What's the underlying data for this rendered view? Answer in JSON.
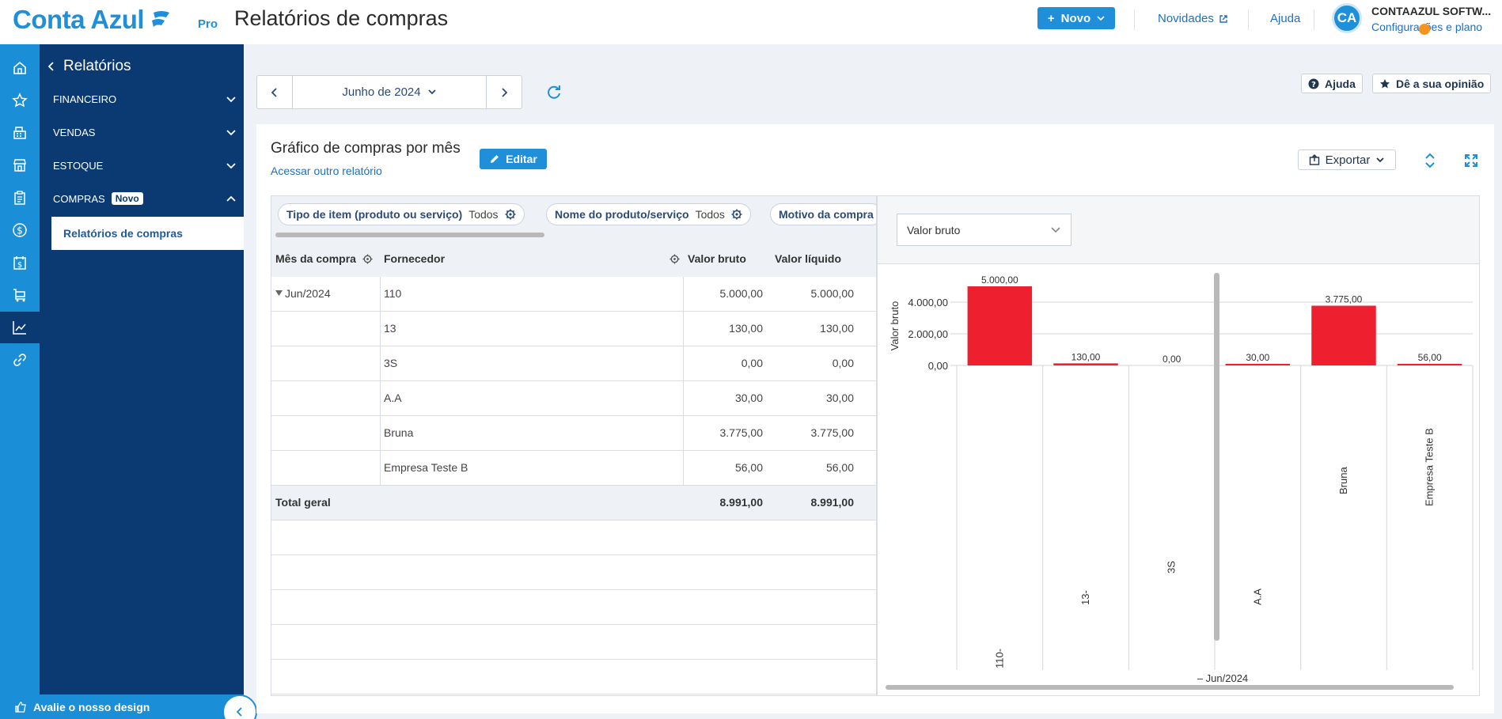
{
  "app": {
    "logo": "Conta Azul",
    "plan": "Pro",
    "page_title": "Relatórios de compras",
    "novo_label": "Novo",
    "novidades_label": "Novidades",
    "ajuda_label": "Ajuda",
    "avatar_initials": "CA",
    "company": "CONTAAZUL SOFTW...",
    "config_link": "Configurações e plano"
  },
  "rail": {
    "icons": [
      "home-icon",
      "star-icon",
      "register-icon",
      "store-icon",
      "clipboard-icon",
      "dollar-icon",
      "calendar-dollar-icon",
      "cart-icon",
      "chart-icon",
      "link-icon"
    ],
    "active": "chart-icon"
  },
  "subnav": {
    "title": "Relatórios",
    "sections": [
      {
        "label": "FINANCEIRO"
      },
      {
        "label": "VENDAS"
      },
      {
        "label": "ESTOQUE"
      },
      {
        "label": "COMPRAS",
        "badge": "Novo"
      }
    ],
    "active_item": "Relatórios de compras",
    "feedback": "Avalie o nosso design"
  },
  "toolbar": {
    "period": "Junho de 2024",
    "help_label": "Ajuda",
    "opinion_label": "Dê a sua opinião"
  },
  "report": {
    "title": "Gráfico de compras por mês",
    "other_link": "Acessar outro relatório",
    "edit_label": "Editar",
    "export_label": "Exportar",
    "filters": [
      {
        "key": "Tipo de item (produto ou serviço)",
        "value": "Todos"
      },
      {
        "key": "Nome do produto/serviço",
        "value": "Todos"
      },
      {
        "key": "Motivo da compra",
        "value": ""
      }
    ],
    "columns": [
      "Mês da compra",
      "Fornecedor",
      "Valor bruto",
      "Valor líquido"
    ],
    "month": "Jun/2024",
    "rows": [
      {
        "fornecedor": "110",
        "bruto": "5.000,00",
        "liquido": "5.000,00"
      },
      {
        "fornecedor": "13",
        "bruto": "130,00",
        "liquido": "130,00"
      },
      {
        "fornecedor": "3S",
        "bruto": "0,00",
        "liquido": "0,00"
      },
      {
        "fornecedor": "A.A",
        "bruto": "30,00",
        "liquido": "30,00"
      },
      {
        "fornecedor": "Bruna",
        "bruto": "3.775,00",
        "liquido": "3.775,00"
      },
      {
        "fornecedor": "Empresa Teste B",
        "bruto": "56,00",
        "liquido": "56,00"
      }
    ],
    "total_label": "Total geral",
    "total_bruto": "8.991,00",
    "total_liquido": "8.991,00",
    "measure_select": "Valor bruto"
  },
  "chart_data": {
    "type": "bar",
    "ylabel": "Valor bruto",
    "xlabel": "Jun/2024",
    "categories": [
      "110",
      "13",
      "3S",
      "A.A",
      "Bruna",
      "Empresa Teste B"
    ],
    "category_labels": [
      "110-",
      "13-",
      "3S",
      "A.A",
      "Bruna",
      "Empresa Teste B"
    ],
    "values": [
      5000,
      130,
      0,
      30,
      3775,
      56
    ],
    "value_labels": [
      "5.000,00",
      "130,00",
      "0,00",
      "30,00",
      "3.775,00",
      "56,00"
    ],
    "yticks": [
      0,
      2000,
      4000
    ],
    "ytick_labels": [
      "0,00",
      "2.000,00",
      "4.000,00"
    ],
    "ylim": [
      0,
      5000
    ],
    "bar_color": "#ee2030",
    "grid": true,
    "legend": "none"
  }
}
